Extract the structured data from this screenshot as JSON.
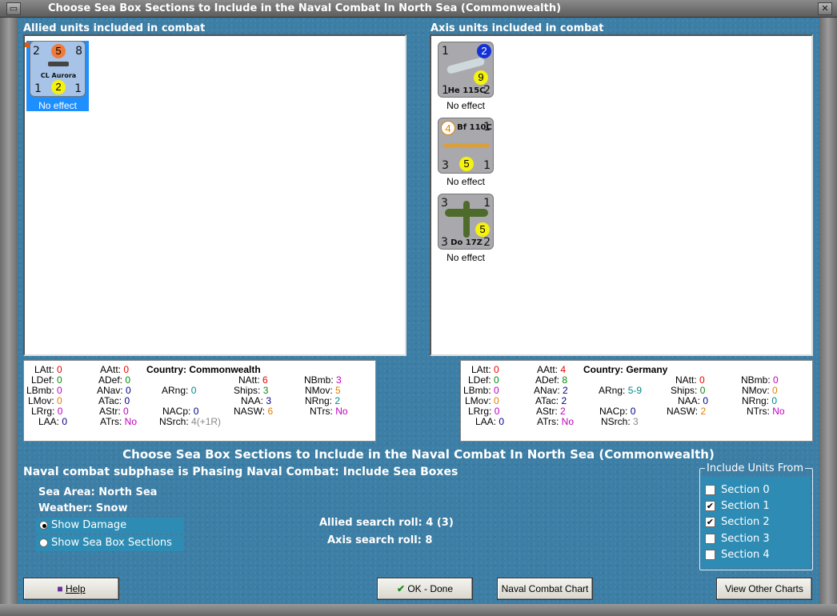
{
  "window": {
    "title": "Choose Sea Box Sections to Include in the Naval Combat In North Sea (Commonwealth)"
  },
  "allied": {
    "header": "Allied units included in combat",
    "units": [
      {
        "name": "CL Aurora",
        "tl": "2",
        "tc": "5",
        "tr": "8",
        "bl": "1",
        "bc": "2",
        "br": "1",
        "effect": "No effect"
      }
    ]
  },
  "axis": {
    "header": "Axis units included in combat",
    "units": [
      {
        "name": "He 115C",
        "tl": "1",
        "tc": "2",
        "br": "2",
        "bl": "1",
        "mid": "9",
        "effect": "No effect"
      },
      {
        "name": "Bf 110C",
        "tl": "4",
        "tr": "1",
        "bl": "3",
        "bc": "5",
        "br": "1",
        "effect": "No effect"
      },
      {
        "name": "Do 17Z",
        "tl": "3",
        "tr": "1",
        "bl": "3",
        "mid": "5",
        "br": "2",
        "effect": "No effect"
      }
    ]
  },
  "allied_stats": {
    "LAtt": "0",
    "LDef": "0",
    "LBmb": "0",
    "LMov": "0",
    "LRrg": "0",
    "LAA": "0",
    "AAtt": "0",
    "ADef": "0",
    "ANav": "0",
    "ATac": "0",
    "AStr": "0",
    "ATrs": "No",
    "country": "Country: Commonwealth",
    "ARng": "0",
    "NACp": "0",
    "NSrch": "4(+1R)",
    "NAtt": "6",
    "Ships": "3",
    "NAA": "3",
    "NASW": "6",
    "NBmb": "3",
    "NMov": "5",
    "NRng": "2",
    "NTrs": "No"
  },
  "axis_stats": {
    "LAtt": "0",
    "LDef": "0",
    "LBmb": "0",
    "LMov": "0",
    "LRrg": "0",
    "LAA": "0",
    "AAtt": "4",
    "ADef": "8",
    "ANav": "2",
    "ATac": "2",
    "AStr": "2",
    "ATrs": "No",
    "country": "Country: Germany",
    "ARng": "5-9",
    "NACp": "0",
    "NSrch": "3",
    "NAtt": "0",
    "Ships": "0",
    "NAA": "0",
    "NASW": "2",
    "NBmb": "0",
    "NMov": "0",
    "NRng": "0",
    "NTrs": "No"
  },
  "labels": {
    "LAtt": "LAtt:",
    "LDef": "LDef:",
    "LBmb": "LBmb:",
    "LMov": "LMov:",
    "LRrg": "LRrg:",
    "LAA": "LAA:",
    "AAtt": "AAtt:",
    "ADef": "ADef:",
    "ANav": "ANav:",
    "ATac": "ATac:",
    "AStr": "AStr:",
    "ATrs": "ATrs:",
    "ARng": "ARng:",
    "NACp": "NACp:",
    "NSrch": "NSrch:",
    "NAtt": "NAtt:",
    "Ships": "Ships:",
    "NAA": "NAA:",
    "NASW": "NASW:",
    "NBmb": "NBmb:",
    "NMov": "NMov:",
    "NRng": "NRng:",
    "NTrs": "NTrs:"
  },
  "main": {
    "heading": "Choose Sea Box Sections to Include in the Naval Combat In North Sea (Commonwealth)",
    "subphase": "Naval combat subphase is Phasing Naval Combat: Include Sea Boxes",
    "sea_area_label": "Sea Area:",
    "sea_area": "North Sea",
    "weather_label": "Weather:",
    "weather": "Snow",
    "radio": [
      "Show Damage",
      "Show Sea Box Sections"
    ],
    "allied_roll": "Allied search roll: 4 (3)",
    "axis_roll": "Axis search roll: 8"
  },
  "include": {
    "title": "Include Units From",
    "sections": [
      {
        "label": "Section 0",
        "checked": false
      },
      {
        "label": "Section 1",
        "checked": true
      },
      {
        "label": "Section 2",
        "checked": true
      },
      {
        "label": "Section 3",
        "checked": false
      },
      {
        "label": "Section 4",
        "checked": false
      }
    ]
  },
  "buttons": {
    "help": "Help",
    "ok": "OK - Done",
    "naval_chart": "Naval Combat Chart",
    "other_charts": "View Other Charts"
  }
}
